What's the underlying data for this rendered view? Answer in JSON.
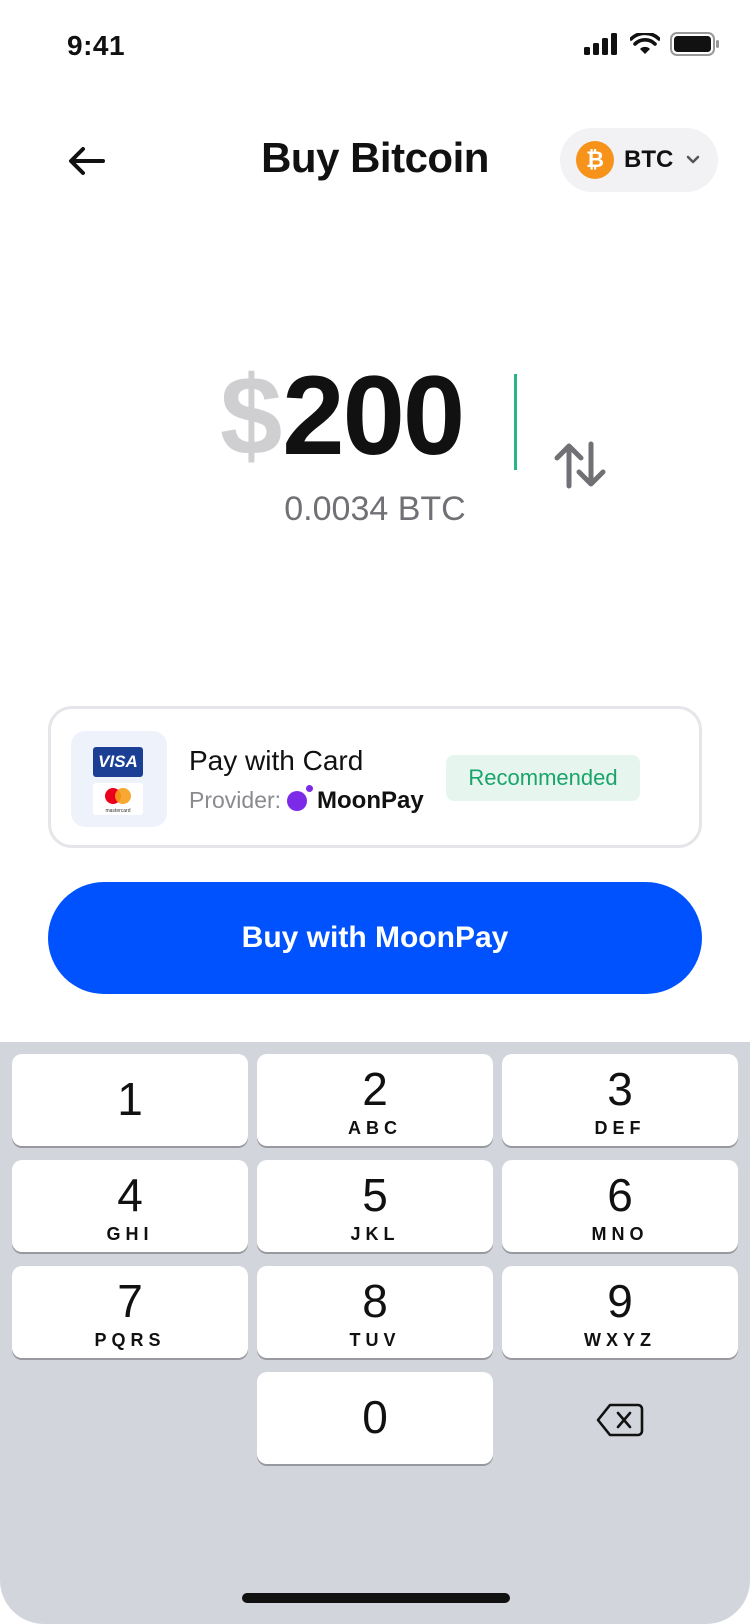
{
  "status_bar": {
    "time": "9:41"
  },
  "header": {
    "title": "Buy Bitcoin",
    "asset": {
      "code": "BTC",
      "symbol": "₿"
    }
  },
  "amount": {
    "currency_symbol": "$",
    "value": "200",
    "converted": "0.0034 BTC"
  },
  "payment": {
    "title": "Pay with Card",
    "provider_label": "Provider:",
    "provider_name": "MoonPay",
    "badge": "Recommended",
    "card_brands": [
      "VISA",
      "mastercard"
    ]
  },
  "actions": {
    "buy_label": "Buy with MoonPay"
  },
  "keypad": {
    "keys": [
      {
        "digit": "1",
        "letters": ""
      },
      {
        "digit": "2",
        "letters": "ABC"
      },
      {
        "digit": "3",
        "letters": "DEF"
      },
      {
        "digit": "4",
        "letters": "GHI"
      },
      {
        "digit": "5",
        "letters": "JKL"
      },
      {
        "digit": "6",
        "letters": "MNO"
      },
      {
        "digit": "7",
        "letters": "PQRS"
      },
      {
        "digit": "8",
        "letters": "TUV"
      },
      {
        "digit": "9",
        "letters": "WXYZ"
      },
      {
        "digit": "0",
        "letters": ""
      }
    ]
  },
  "colors": {
    "accent": "#0052ff",
    "bitcoin": "#f7931a",
    "recommended_bg": "#e6f6ef",
    "recommended_text": "#1aa46a",
    "caret": "#2bb38a",
    "moonpay": "#7d2ae8"
  },
  "icons": [
    "back-arrow-icon",
    "chevron-down-icon",
    "swap-icon",
    "delete-icon",
    "signal-icon",
    "wifi-icon",
    "battery-icon"
  ]
}
